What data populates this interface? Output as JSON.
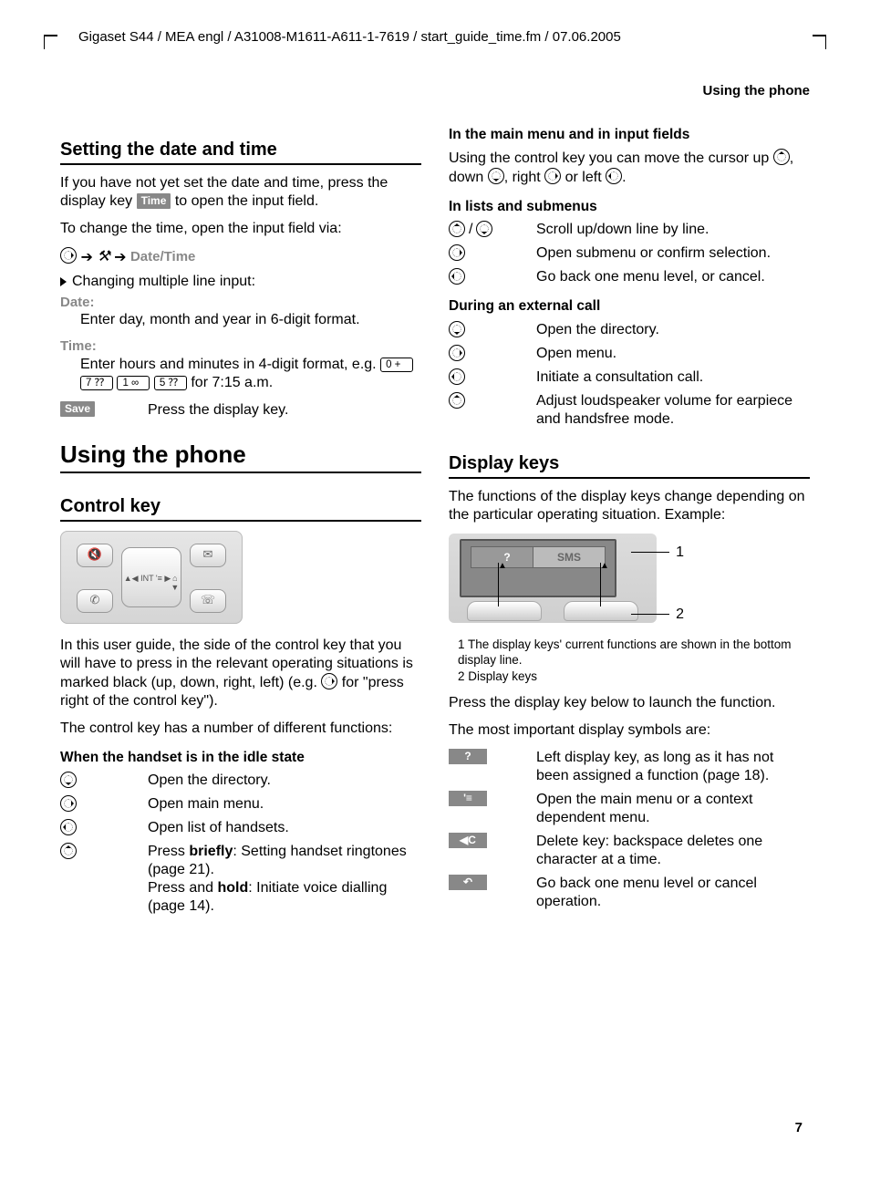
{
  "header": "Gigaset S44 / MEA engl / A31008-M1611-A611-1-7619 / start_guide_time.fm / 07.06.2005",
  "runningHead": "Using the phone",
  "pageNumber": "7",
  "left": {
    "h_setting": "Setting the date and time",
    "p1a": "If you have not yet set the date and time, press the display key ",
    "time_badge": "Time",
    "p1b": " to open the input field.",
    "p2": "To change the time, open the input field via:",
    "navpath_end": "Date/Time",
    "bullet_change": "Changing multiple line input:",
    "lbl_date": "Date:",
    "date_text": "Enter day, month and year in 6-digit format.",
    "lbl_time": "Time:",
    "time_text_a": "Enter hours and minutes in 4-digit format, e.g. ",
    "num0": "0 +",
    "num7": "7 ⁇",
    "num1": "1 ∞",
    "num5": "5 ⁇",
    "time_text_b": " for 7:15 a.m.",
    "save_badge": "Save",
    "save_text": "Press the display key.",
    "h_using": "Using the phone",
    "h_control": "Control key",
    "ck_center_lbl": "◀ INT    '≡ ▶",
    "p_ck1": "In this user guide, the side of the control key that you will have to press in the relevant operating situations is marked black (up, down, right, left) (e.g. ",
    "p_ck1b": " for \"press right of the control key\").",
    "p_ck2": "The control key has a number of different functions:",
    "h_idle": "When the handset is in the idle state",
    "idle1": "Open the directory.",
    "idle2": "Open main menu.",
    "idle3": "Open list of handsets.",
    "idle4a": "Press ",
    "idle4_briefly": "briefly",
    "idle4b": ": Setting handset ringtones (page 21).",
    "idle4c": "Press and ",
    "idle4_hold": "hold",
    "idle4d": ": Initiate voice dialling (page 14)."
  },
  "right": {
    "h_mainmenu": "In the main menu and in input fields",
    "p_mm_a": "Using the control key you can move the cursor up ",
    "p_mm_b": ", down ",
    "p_mm_c": ", right ",
    "p_mm_d": " or left ",
    "p_mm_e": ".",
    "h_lists": "In lists and submenus",
    "lists1": "Scroll up/down line by line.",
    "lists2": "Open submenu or confirm selection.",
    "lists3": "Go back one menu level, or cancel.",
    "h_ext": "During an external call",
    "ext1": "Open the directory.",
    "ext2": "Open menu.",
    "ext3": "Initiate a consultation call.",
    "ext4": "Adjust loudspeaker volume for earpiece and handsfree mode.",
    "h_display": "Display keys",
    "p_dk1": "The functions of the display keys change depending on the particular operating situation. Example:",
    "callout1": "1",
    "callout2": "2",
    "dp_q": "?",
    "dp_sms": "SMS",
    "cap1": "1 The display keys' current functions are shown in the bottom display line.",
    "cap2": "2 Display keys",
    "p_dk2": "Press the display key below to launch the function.",
    "p_dk3": "The most important display symbols are:",
    "sym_q": "?",
    "sym_q_text": "Left display key, as long as it has not been assigned a function (page 18).",
    "sym_menu": "'≡",
    "sym_menu_text": "Open the main menu or a context dependent menu.",
    "sym_del": "◀C",
    "sym_del_text": "Delete key: backspace deletes one character at a time.",
    "sym_back": "↶",
    "sym_back_text": "Go back one menu level or cancel operation."
  }
}
